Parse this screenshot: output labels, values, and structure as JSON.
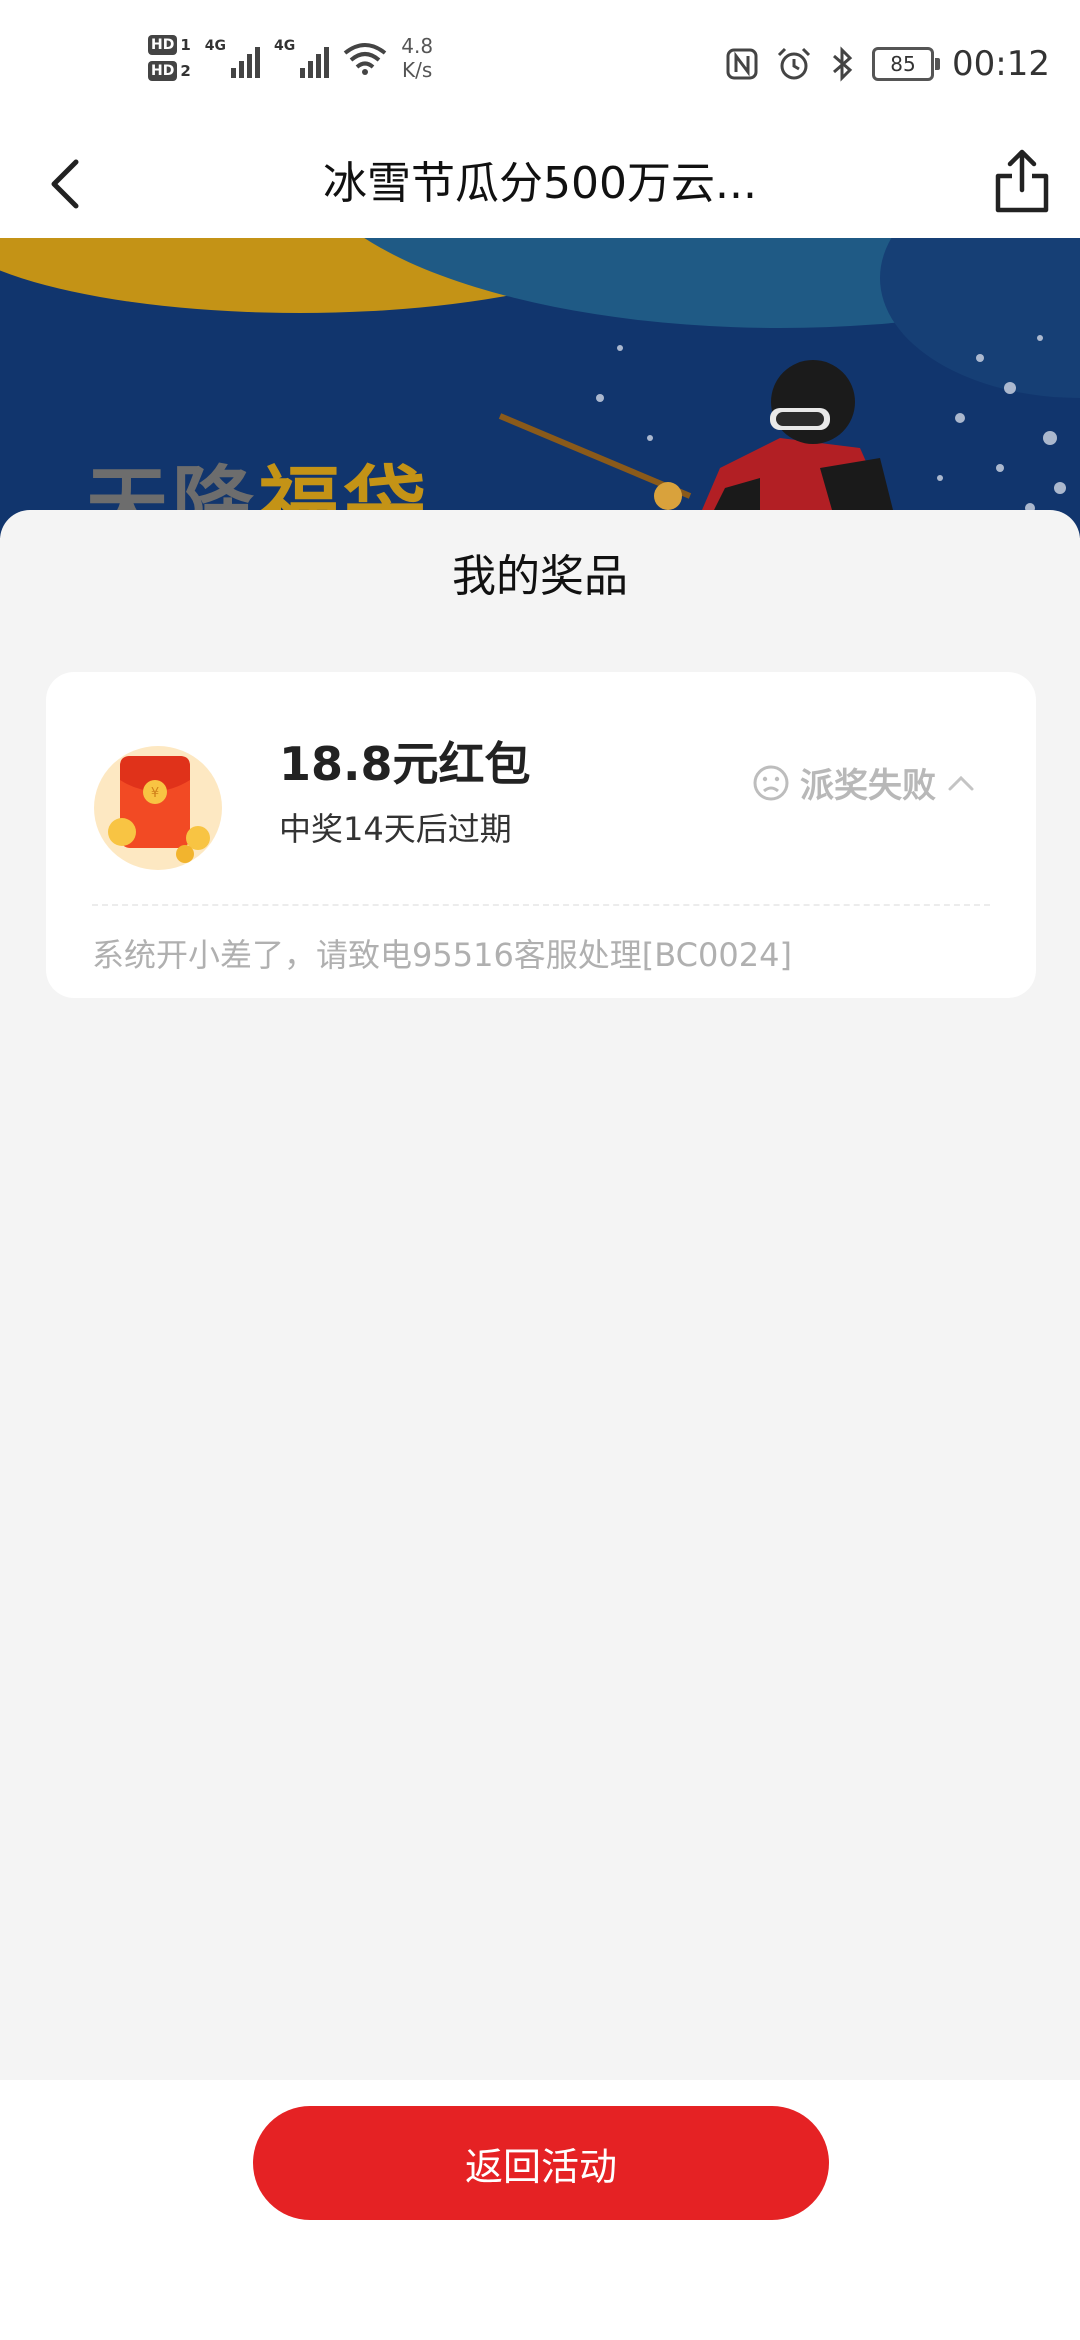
{
  "status_bar": {
    "sim1": "HD",
    "sim1_slot": "1",
    "sim2": "HD",
    "sim2_slot": "2",
    "network1": "4G",
    "network2": "4G",
    "speed_value": "4.8",
    "speed_unit": "K/s",
    "battery": "85",
    "time": "00:12",
    "icons": [
      "nfc-icon",
      "alarm-icon",
      "bluetooth-icon",
      "battery-icon",
      "wifi-icon",
      "signal-icon"
    ]
  },
  "nav": {
    "title": "冰雪节瓜分500万云...",
    "back_icon": "chevron-left-icon",
    "share_icon": "share-icon"
  },
  "banner": {
    "text_part1": "天降",
    "text_part2": "福袋"
  },
  "sheet": {
    "title": "我的奖品"
  },
  "prize": {
    "name": "18.8元红包",
    "expiry": "中奖14天后过期",
    "status": "派奖失败",
    "error": "系统开小差了，请致电95516客服处理[BC0024]",
    "icon": "red-envelope-icon",
    "status_icon": "sad-face-icon",
    "toggle_icon": "chevron-up-icon"
  },
  "footer": {
    "button_label": "返回活动"
  },
  "colors": {
    "accent": "#e52224",
    "background": "#f4f4f4",
    "muted": "#b8b8b8"
  }
}
